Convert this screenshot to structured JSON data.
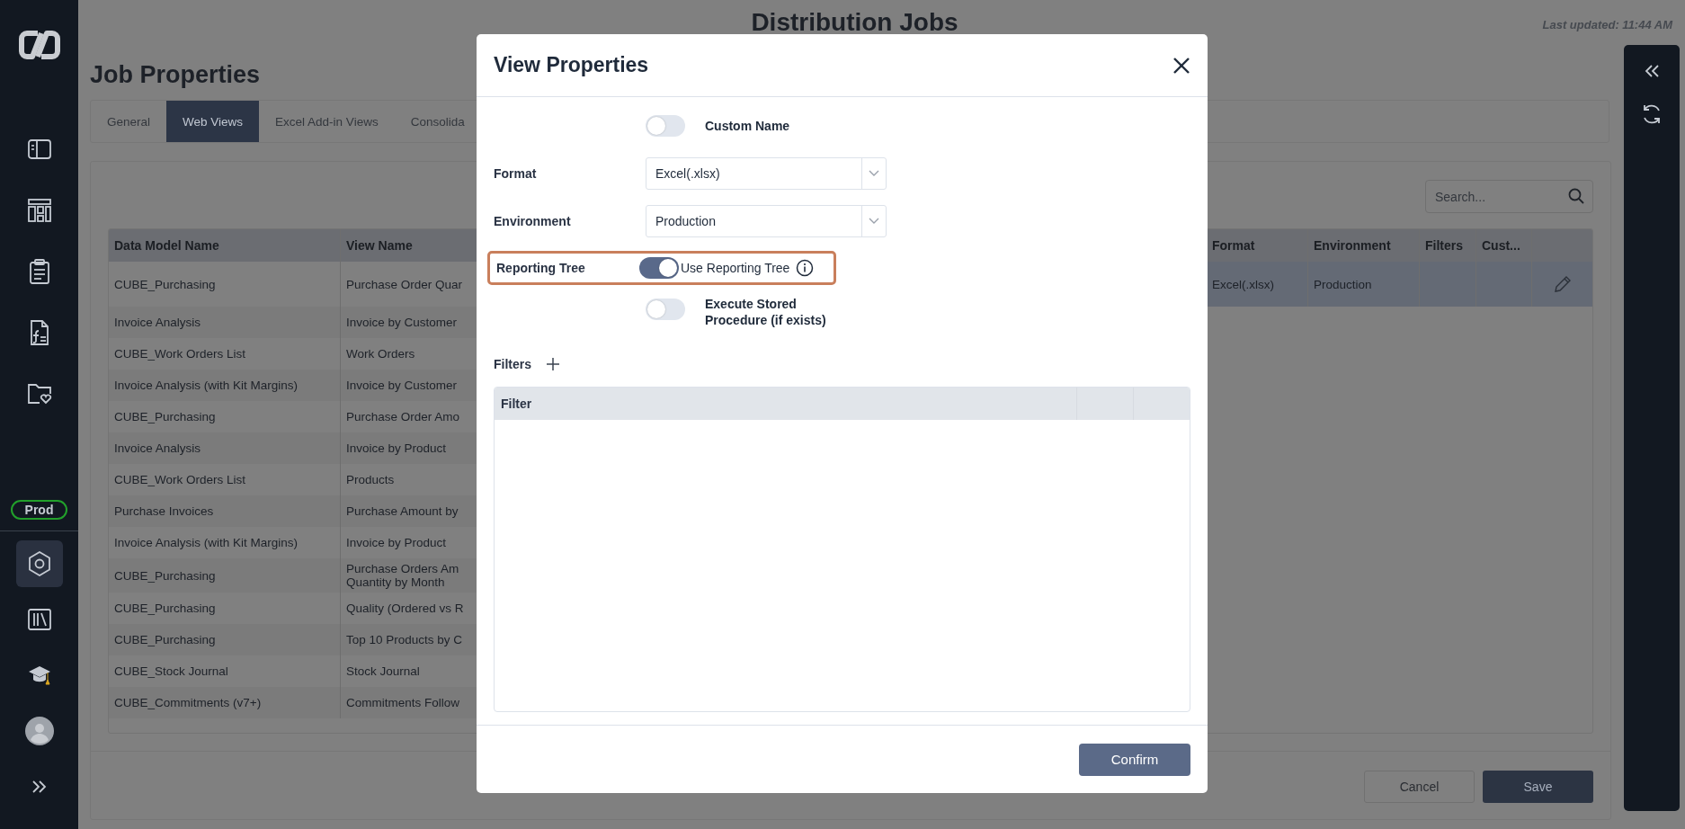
{
  "header": {
    "title": "Distribution Jobs",
    "last_updated": "Last updated: 11:44 AM"
  },
  "sidebar": {
    "top_items": [
      {
        "kind": "panel",
        "selected": false
      },
      {
        "kind": "dashboard",
        "selected": false
      },
      {
        "kind": "clipboard",
        "selected": false
      },
      {
        "kind": "formula",
        "selected": false
      },
      {
        "kind": "folder",
        "selected": false
      }
    ],
    "env_badge": "Prod",
    "bottom_items": [
      {
        "kind": "hexagon",
        "selected": true
      },
      {
        "kind": "library",
        "selected": false
      },
      {
        "kind": "cap",
        "selected": false
      },
      {
        "kind": "avatar",
        "selected": false
      },
      {
        "kind": "expand",
        "selected": false
      }
    ]
  },
  "page": {
    "title": "Job Properties",
    "tabs": [
      {
        "label": "General",
        "selected": false
      },
      {
        "label": "Web Views",
        "selected": true
      },
      {
        "label": "Excel Add-in Views",
        "selected": false
      },
      {
        "label": "Consolida",
        "selected": false
      }
    ],
    "search": {
      "placeholder": "Search..."
    },
    "table": {
      "columns": [
        "Data Model Name",
        "View Name",
        "Format",
        "Environment",
        "Filters",
        "Cust..."
      ],
      "rows": [
        {
          "data_model": "CUBE_Purchasing",
          "view_name": "Purchase Order Quar",
          "format": "Excel(.xlsx)",
          "environment": "Production",
          "selected": true
        },
        {
          "data_model": "Invoice Analysis",
          "view_name": "Invoice by Customer",
          "selected": false
        },
        {
          "data_model": "CUBE_Work Orders List",
          "view_name": "Work Orders",
          "selected": false
        },
        {
          "data_model": "Invoice Analysis (with Kit Margins)",
          "view_name": "Invoice by Customer",
          "selected": false
        },
        {
          "data_model": "CUBE_Purchasing",
          "view_name": "Purchase Order Amo",
          "selected": false
        },
        {
          "data_model": "Invoice Analysis",
          "view_name": "Invoice by Product",
          "selected": false
        },
        {
          "data_model": "CUBE_Work Orders List",
          "view_name": "Products",
          "selected": false
        },
        {
          "data_model": "Purchase Invoices",
          "view_name": "Purchase Amount by",
          "selected": false
        },
        {
          "data_model": "Invoice Analysis (with Kit Margins)",
          "view_name": "Invoice by Product",
          "selected": false
        },
        {
          "data_model": "CUBE_Purchasing",
          "view_name": "Purchase Orders Am Quantity by Month",
          "selected": false
        },
        {
          "data_model": "CUBE_Purchasing",
          "view_name": "Quality (Ordered vs R",
          "selected": false
        },
        {
          "data_model": "CUBE_Purchasing",
          "view_name": "Top 10 Products by C",
          "selected": false
        },
        {
          "data_model": "CUBE_Stock Journal",
          "view_name": "Stock Journal",
          "selected": false
        },
        {
          "data_model": "CUBE_Commitments (v7+)",
          "view_name": "Commitments Follow",
          "selected": false
        }
      ]
    },
    "buttons": {
      "cancel": "Cancel",
      "save": "Save"
    }
  },
  "modal": {
    "title": "View Properties",
    "custom_name": {
      "label": "Custom Name",
      "on": false
    },
    "format": {
      "label": "Format",
      "value": "Excel(.xlsx)"
    },
    "environment": {
      "label": "Environment",
      "value": "Production"
    },
    "reporting_tree": {
      "label": "Reporting Tree",
      "toggle_label": "Use Reporting Tree",
      "on": true,
      "highlighted": true
    },
    "execute_stored_procedure": {
      "label": "Execute Stored Procedure (if exists)",
      "on": false
    },
    "filters": {
      "label": "Filters",
      "columns": [
        "Filter"
      ]
    },
    "confirm": "Confirm"
  }
}
